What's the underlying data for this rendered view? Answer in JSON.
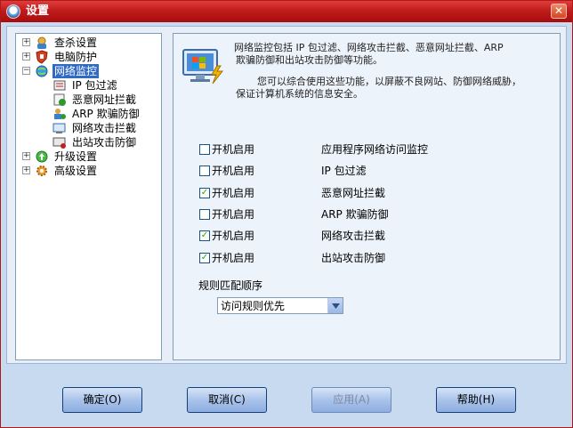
{
  "window": {
    "title": "设置",
    "close_symbol": "✕"
  },
  "tree": {
    "items": [
      {
        "label": "查杀设置",
        "icon": "scan-icon",
        "expander": "+"
      },
      {
        "label": "电脑防护",
        "icon": "shield-icon",
        "expander": "+"
      },
      {
        "label": "网络监控",
        "icon": "network-globe-icon",
        "expander": "−",
        "selected": true
      },
      {
        "label": "IP 包过滤",
        "icon": "ip-filter-icon"
      },
      {
        "label": "恶意网址拦截",
        "icon": "malicious-url-icon"
      },
      {
        "label": "ARP 欺骗防御",
        "icon": "arp-defense-icon"
      },
      {
        "label": "网络攻击拦截",
        "icon": "attack-block-icon"
      },
      {
        "label": "出站攻击防御",
        "icon": "outbound-defense-icon"
      },
      {
        "label": "升级设置",
        "icon": "upgrade-icon",
        "expander": "+"
      },
      {
        "label": "高级设置",
        "icon": "advanced-gear-icon",
        "expander": "+"
      }
    ]
  },
  "content": {
    "description_1": [
      "网络监控包括 IP 包过滤、网络攻击拦截、恶意网址拦截、ARP",
      "欺骗防御和出站攻击防御等功能。"
    ],
    "description_2": [
      "您可以综合使用这些功能，以屏蔽不良网站、防御网络威胁，",
      "保证计算机系统的信息安全。"
    ],
    "options": [
      {
        "checkbox_label": "开机启用",
        "feature": "应用程序网络访问监控",
        "checked": false
      },
      {
        "checkbox_label": "开机启用",
        "feature": "IP 包过滤",
        "checked": false
      },
      {
        "checkbox_label": "开机启用",
        "feature": "恶意网址拦截",
        "checked": true
      },
      {
        "checkbox_label": "开机启用",
        "feature": "ARP 欺骗防御",
        "checked": false
      },
      {
        "checkbox_label": "开机启用",
        "feature": "网络攻击拦截",
        "checked": true
      },
      {
        "checkbox_label": "开机启用",
        "feature": "出站攻击防御",
        "checked": true
      }
    ],
    "rule_order_label": "规则匹配顺序",
    "rule_order_value": "访问规则优先"
  },
  "buttons": {
    "ok": "确定(O)",
    "cancel": "取消(C)",
    "apply": "应用(A)",
    "help": "帮助(H)"
  },
  "colors": {
    "title_red": "#c01c1c",
    "selected_blue": "#316ac5",
    "check_green": "#21a121"
  }
}
